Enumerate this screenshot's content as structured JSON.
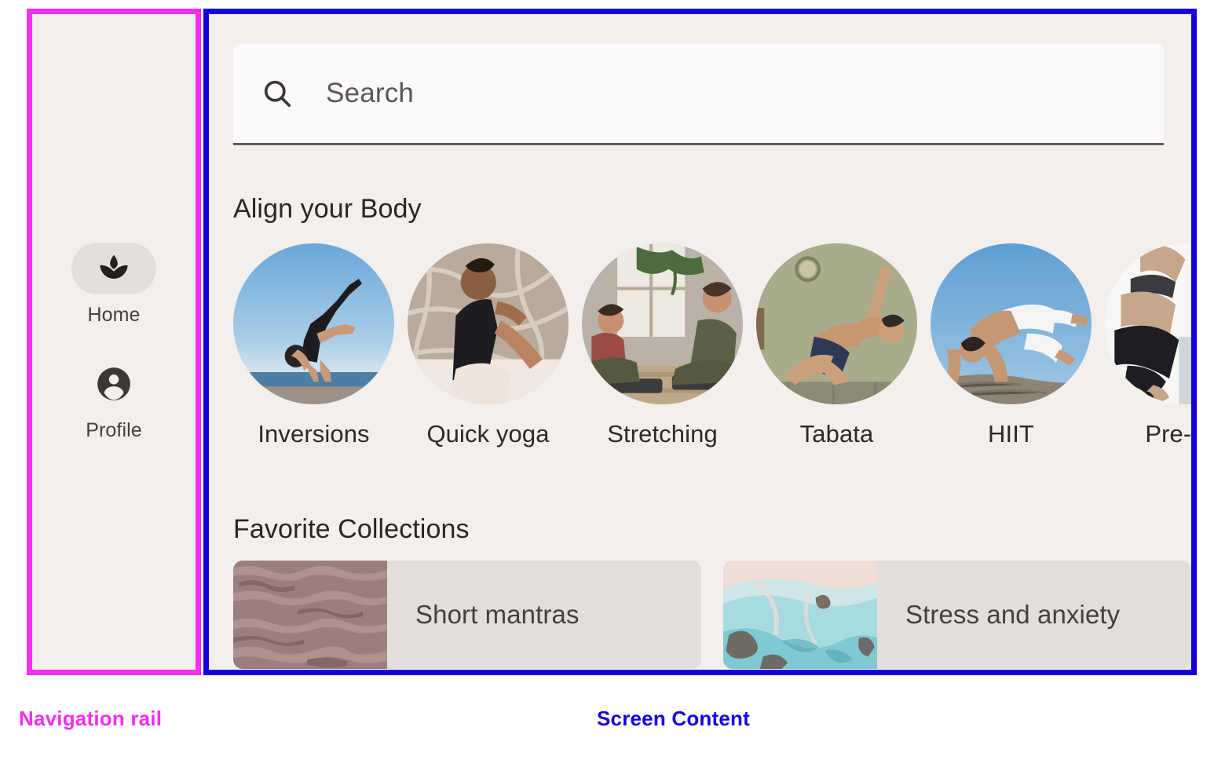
{
  "annotations": {
    "nav_rail": {
      "label": "Navigation rail",
      "color": "#f32ff0"
    },
    "screen_content": {
      "label": "Screen Content",
      "color": "#1400e0"
    }
  },
  "nav_rail": {
    "items": [
      {
        "label": "Home",
        "icon": "spa-lotus-icon",
        "selected": true
      },
      {
        "label": "Profile",
        "icon": "account-circle-icon",
        "selected": false
      }
    ]
  },
  "screen": {
    "search": {
      "placeholder": "Search",
      "value": "",
      "icon": "search-icon"
    },
    "sections": [
      {
        "title": "Align your Body",
        "items": [
          {
            "label": "Inversions",
            "image": "woman-handstand-beach-blue-sky"
          },
          {
            "label": "Quick yoga",
            "image": "woman-seated-twist-outdoors"
          },
          {
            "label": "Stretching",
            "image": "two-women-stretching-studio"
          },
          {
            "label": "Tabata",
            "image": "man-side-plank-sage-wall"
          },
          {
            "label": "HIIT",
            "image": "man-backbend-rock-blue-sky"
          },
          {
            "label": "Pre-nat",
            "image": "prenatal-woman-white-background"
          }
        ]
      },
      {
        "title": "Favorite Collections",
        "cards": [
          {
            "label": "Short mantras",
            "image": "rippled-water-mauve-texture"
          },
          {
            "label": "Stress and anxiety",
            "image": "turquoise-marble-texture"
          }
        ]
      }
    ]
  },
  "colors": {
    "surface": "#f3efed",
    "search_field": "#fbf9fb",
    "selected_pill": "#e4dfdc",
    "card_surface": "#e2dedb",
    "on_surface": "#2a2624"
  }
}
